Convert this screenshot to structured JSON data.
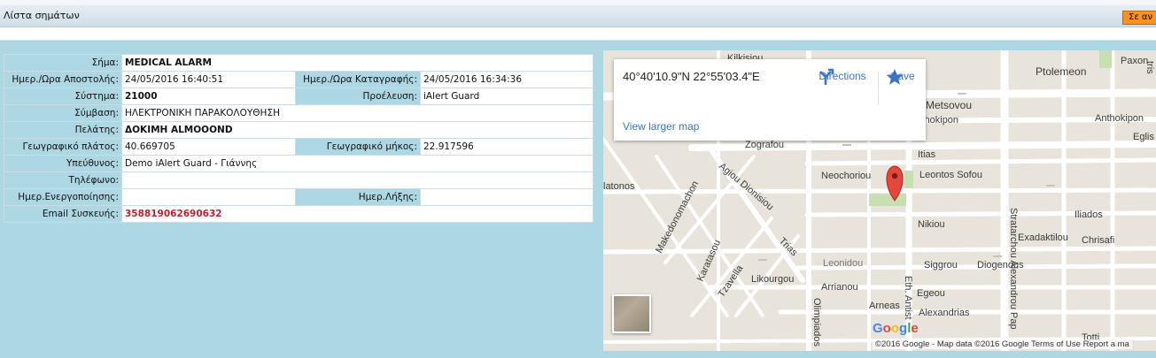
{
  "header": {
    "title": "Λίστα σημάτων",
    "action_button": "Σε αν"
  },
  "details": {
    "signal_label": "Σήμα:",
    "signal_value": "MEDICAL ALARM",
    "send_time_label": "Ημερ./Ωρα Αποστολής:",
    "send_time_value": "24/05/2016 16:40:51",
    "record_time_label": "Ημερ./Ωρα Καταγραφής:",
    "record_time_value": "24/05/2016 16:34:36",
    "system_label": "Σύστημα:",
    "system_value": "21000",
    "origin_label": "Προέλευση:",
    "origin_value": "iAlert Guard",
    "contract_label": "Σύμβαση:",
    "contract_value": "ΗΛΕΚΤΡΟΝΙΚΗ ΠΑΡΑΚΟΛΟΥΘΗΣΗ",
    "client_label": "Πελάτης:",
    "client_value": "ΔΟΚΙΜΗ ALMOOOND",
    "latitude_label": "Γεωγραφικό πλάτος:",
    "latitude_value": "40.669705",
    "longitude_label": "Γεωγραφικό μήκος:",
    "longitude_value": "22.917596",
    "responsible_label": "Υπεύθυνος:",
    "responsible_value": "Demo iAlert Guard - Γιάννης",
    "phone_label": "Τηλέφωνο:",
    "phone_value": "",
    "activation_label": "Ημερ.Ενεργοποίησης:",
    "activation_value": "",
    "expiry_label": "Ημερ.Λήξης:",
    "expiry_value": "",
    "email_label": "Email Συσκευής:",
    "email_value": "358819062690632"
  },
  "map": {
    "coords": "40°40'10.9\"N 22°55'03.4\"E",
    "directions_label": "Directions",
    "save_label": "Save",
    "view_larger_label": "View larger map",
    "copyright": "©2016 Google - Map data ©2016 Google    Terms of Use    Report a ma",
    "logo_letters": [
      "G",
      "o",
      "o",
      "g",
      "l",
      "e"
    ],
    "streets": {
      "kilkisiou": "Kilkisiou",
      "ptolemeon": "Ptolemeon",
      "paxon": "Paxon",
      "metsovou": "Metsovou",
      "anthokipon1": "Anthokipon",
      "anthokipon2": "Anthokipon",
      "eglis": "Eglis",
      "zografou": "Zografou",
      "itias": "Itias",
      "neochoriou": "Neochoriou",
      "leontos": "Leontos Sofou",
      "agiou": "Agiou Dionisiou",
      "latonos": "latonos",
      "makedonomachon": "Makedonomachon",
      "iliados": "Iliados",
      "nikiou": "Nikiou",
      "exadaktilou": "Exadaktilou",
      "chrisafi": "Chrisafi",
      "karatasou": "Karatasou",
      "trias": "Trias",
      "strat": "Stratarchou Alexandrou Pap",
      "leonidou": "Leonidou",
      "siggrou": "Siggrou",
      "diogenous": "Diogenous",
      "tzavella": "Tzavella",
      "likourgou": "Likourgou",
      "arrianou": "Arrianou",
      "egeou": "Egeou",
      "arneas": "Arneas",
      "alexandrias": "Alexandrias",
      "eth": "Eth. Antist",
      "olimpiados": "Olimpiados",
      "totti": "Totti",
      "tris": "tris"
    }
  }
}
